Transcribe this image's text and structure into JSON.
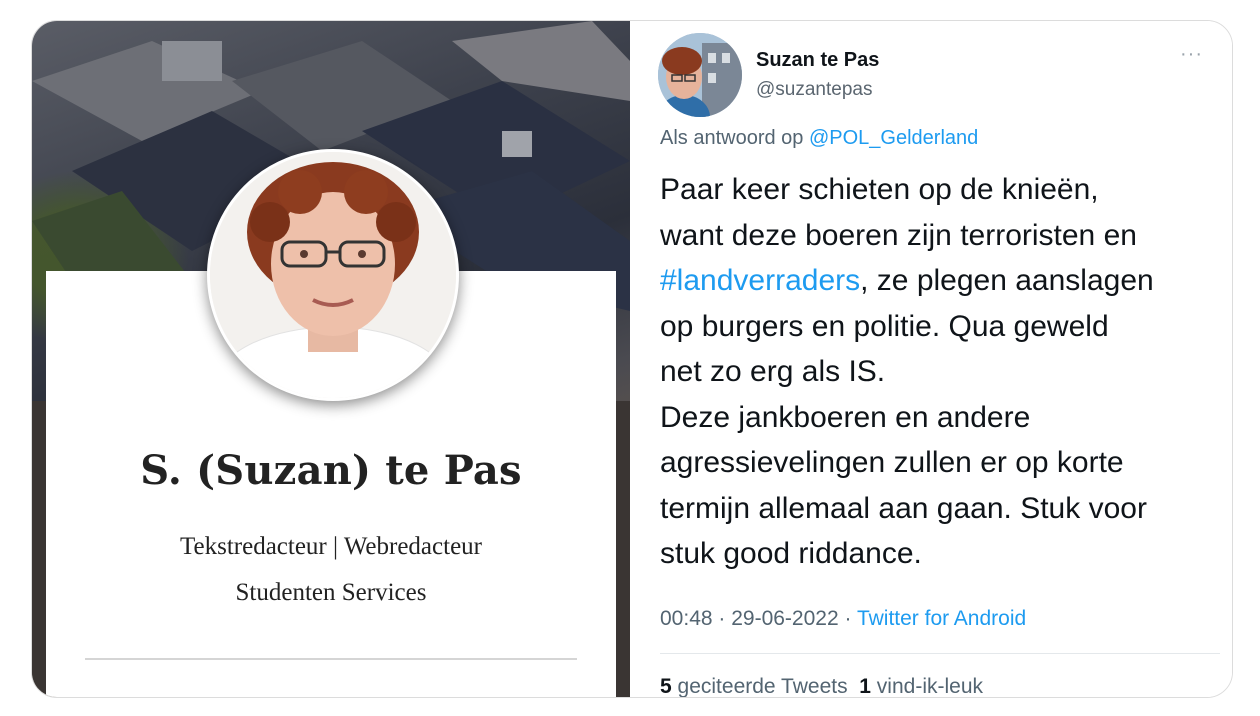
{
  "profile": {
    "name": "S. (Suzan) te Pas",
    "role": "Tekstredacteur | Webredacteur",
    "organization": "Studenten Services"
  },
  "tweet": {
    "display_name": "Suzan te Pas",
    "handle": "@suzantepas",
    "more_icon": "ellipsis-icon",
    "reply_prefix": "Als antwoord op",
    "reply_to": "@POL_Gelderland",
    "body_lines": [
      "Paar keer schieten op de knieën,",
      "want deze boeren zijn terroristen en",
      {
        "hashtag": "#landverraders",
        "rest": ", ze plegen aanslagen"
      },
      "op burgers en politie. Qua geweld",
      "net zo erg als IS.",
      "Deze jankboeren en andere",
      "agressievelingen zullen er op korte",
      "termijn allemaal aan gaan. Stuk voor",
      "stuk good riddance."
    ],
    "time_date": "00:48 · 29-06-2022 ·",
    "source": "Twitter for Android",
    "quote_count": "5",
    "quote_label": "geciteerde Tweets",
    "like_count": "1",
    "like_label": "vind-ik-leuk"
  },
  "colors": {
    "link": "#1d9bf0",
    "text": "#0f1419",
    "muted": "#536471"
  }
}
